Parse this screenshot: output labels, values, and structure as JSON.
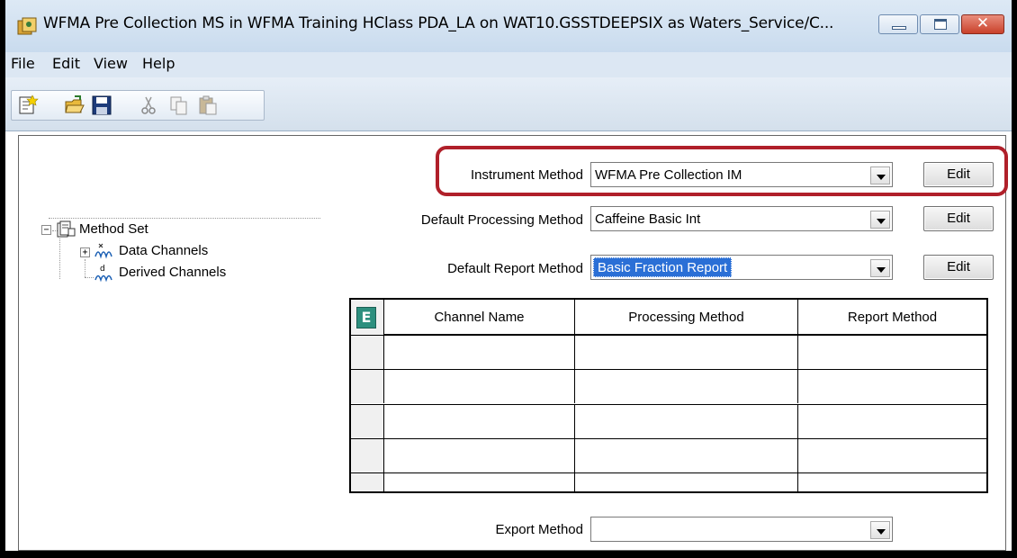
{
  "window": {
    "title": "WFMA Pre Collection MS in WFMA Training HClass PDA_LA on WAT10.GSSTDEEPSIX as Waters_Service/C...",
    "close_glyph": "✕"
  },
  "menu": [
    "File",
    "Edit",
    "View",
    "Help"
  ],
  "toolbar": {
    "icons": [
      "new-method-icon",
      "open-icon",
      "save-icon",
      "cut-icon",
      "copy-icon",
      "paste-icon"
    ]
  },
  "tree": {
    "root": {
      "label": "Method Set",
      "expander": "⊟"
    },
    "children": [
      {
        "label": "Data Channels",
        "expander": "⊞"
      },
      {
        "label": "Derived Channels"
      }
    ]
  },
  "form": {
    "instrument_method": {
      "label": "Instrument Method",
      "value": "WFMA Pre Collection IM",
      "button": "Edit"
    },
    "processing_method": {
      "label": "Default Processing Method",
      "value": "Caffeine Basic Int",
      "button": "Edit"
    },
    "report_method": {
      "label": "Default Report Method",
      "value": "Basic Fraction Report",
      "button": "Edit"
    },
    "export_method": {
      "label": "Export Method",
      "value": ""
    }
  },
  "grid": {
    "corner_icon": "E",
    "columns": [
      "Channel Name",
      "Processing Method",
      "Report Method"
    ],
    "rows": [
      [
        "",
        "",
        ""
      ],
      [
        "",
        "",
        ""
      ],
      [
        "",
        "",
        ""
      ],
      [
        "",
        "",
        ""
      ],
      [
        "",
        "",
        ""
      ]
    ]
  },
  "colors": {
    "highlight": "#b0202a",
    "selection": "#2a6fd6",
    "titlebar": "#c9dbee"
  }
}
